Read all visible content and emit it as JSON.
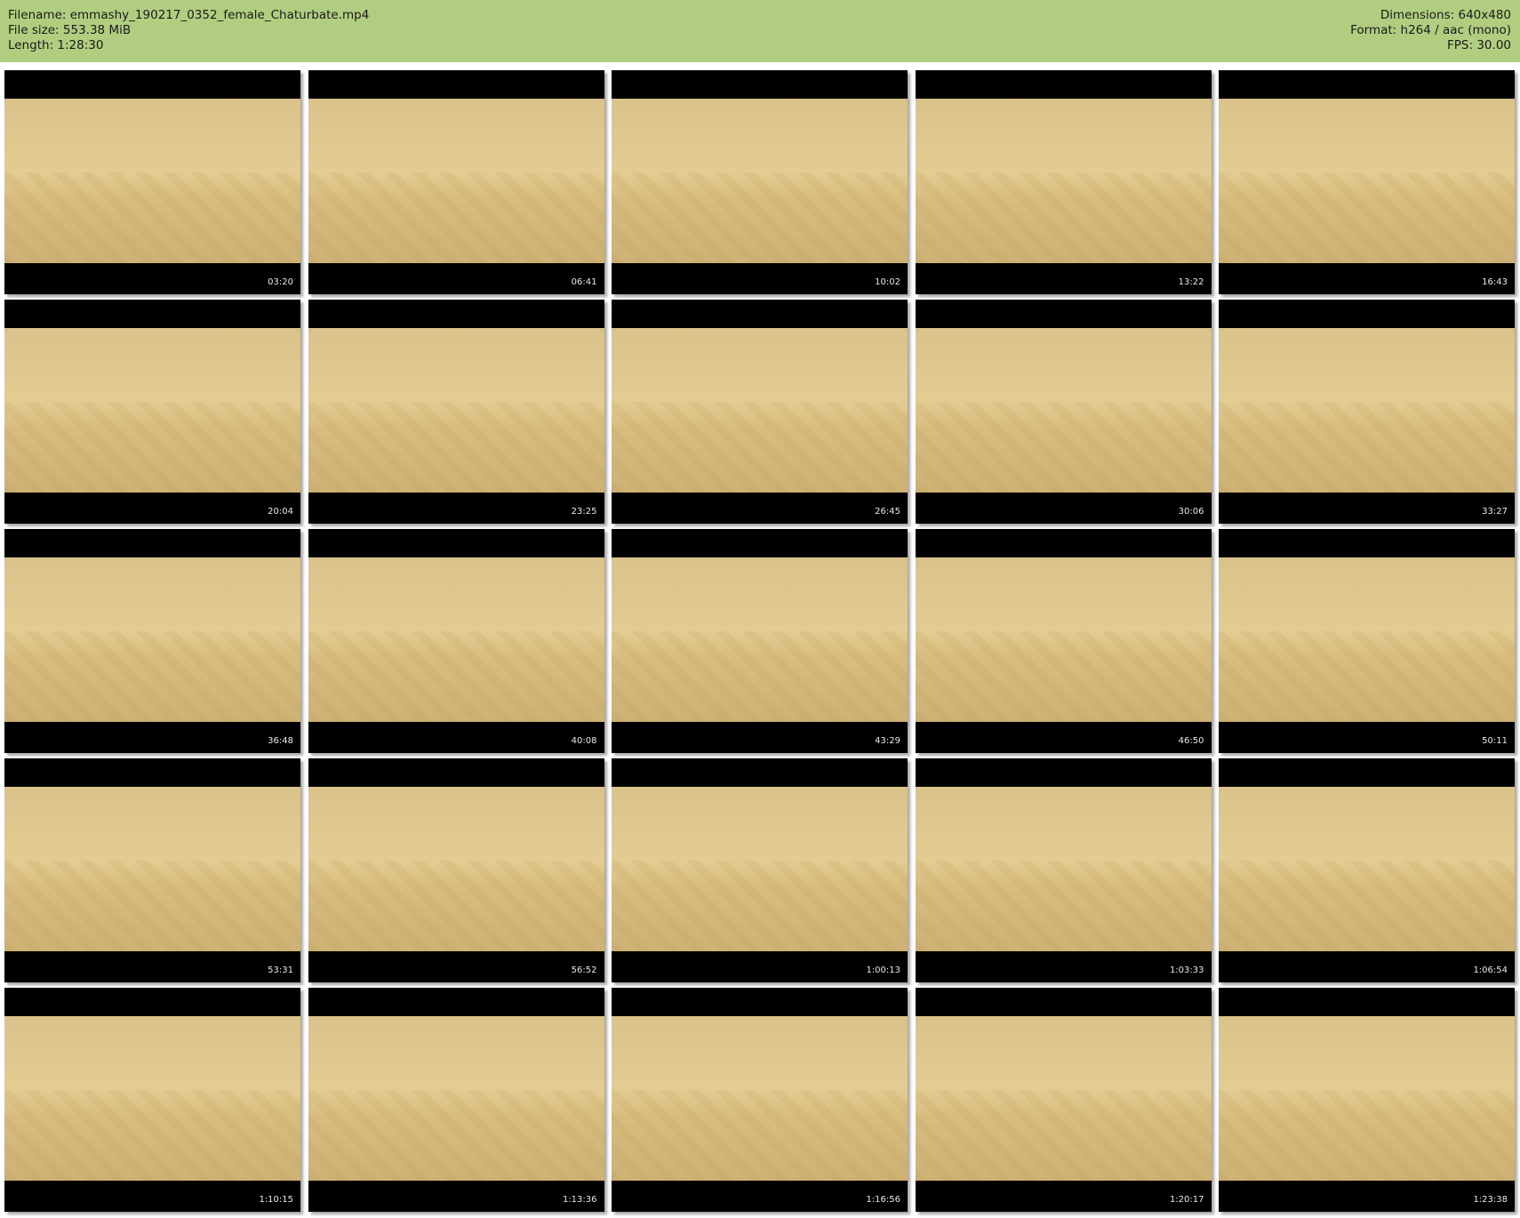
{
  "header": {
    "filename": "Filename: emmashy_190217_0352_female_Chaturbate.mp4",
    "file_size": "File size: 553.38 MiB",
    "length": "Length: 1:28:30",
    "dimensions": "Dimensions: 640x480",
    "format": "Format: h264 / aac (mono)",
    "fps": "FPS: 30.00"
  },
  "colors": {
    "header_bg": "#b1cd80"
  },
  "thumbnails": [
    {
      "time": "03:20"
    },
    {
      "time": "06:41"
    },
    {
      "time": "10:02"
    },
    {
      "time": "13:22"
    },
    {
      "time": "16:43"
    },
    {
      "time": "20:04"
    },
    {
      "time": "23:25"
    },
    {
      "time": "26:45"
    },
    {
      "time": "30:06"
    },
    {
      "time": "33:27"
    },
    {
      "time": "36:48"
    },
    {
      "time": "40:08"
    },
    {
      "time": "43:29"
    },
    {
      "time": "46:50"
    },
    {
      "time": "50:11"
    },
    {
      "time": "53:31"
    },
    {
      "time": "56:52"
    },
    {
      "time": "1:00:13"
    },
    {
      "time": "1:03:33"
    },
    {
      "time": "1:06:54"
    },
    {
      "time": "1:10:15"
    },
    {
      "time": "1:13:36"
    },
    {
      "time": "1:16:56"
    },
    {
      "time": "1:20:17"
    },
    {
      "time": "1:23:38"
    }
  ]
}
